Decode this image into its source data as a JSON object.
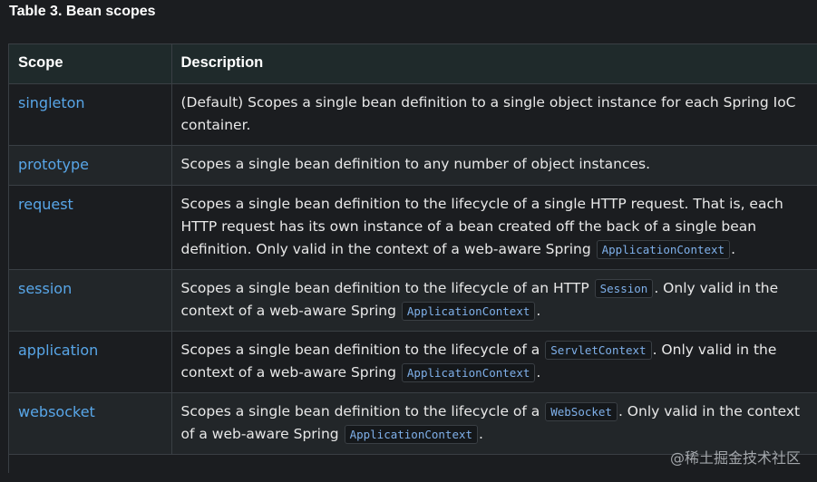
{
  "caption": "Table 3. Bean scopes",
  "header": {
    "scope": "Scope",
    "description": "Description"
  },
  "rows": [
    {
      "scope": "singleton",
      "parts": [
        "(Default) Scopes a single bean definition to a single object instance for each Spring IoC container."
      ],
      "codes": []
    },
    {
      "scope": "prototype",
      "parts": [
        "Scopes a single bean definition to any number of object instances."
      ],
      "codes": []
    },
    {
      "scope": "request",
      "parts": [
        "Scopes a single bean definition to the lifecycle of a single HTTP request. That is, each HTTP request has its own instance of a bean created off the back of a single bean definition. Only valid in the context of a web-aware Spring ",
        "."
      ],
      "codes": [
        "ApplicationContext"
      ]
    },
    {
      "scope": "session",
      "parts": [
        "Scopes a single bean definition to the lifecycle of an HTTP ",
        ". Only valid in the context of a web-aware Spring ",
        "."
      ],
      "codes": [
        "Session",
        "ApplicationContext"
      ]
    },
    {
      "scope": "application",
      "parts": [
        "Scopes a single bean definition to the lifecycle of a ",
        ". Only valid in the context of a web-aware Spring ",
        "."
      ],
      "codes": [
        "ServletContext",
        "ApplicationContext"
      ]
    },
    {
      "scope": "websocket",
      "parts": [
        "Scopes a single bean definition to the lifecycle of a ",
        ". Only valid in the context of a web-aware Spring ",
        "."
      ],
      "codes": [
        "WebSocket",
        "ApplicationContext"
      ]
    }
  ],
  "watermark": "@稀土掘金技术社区"
}
